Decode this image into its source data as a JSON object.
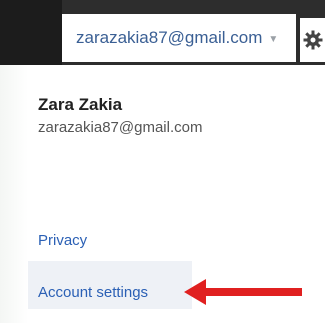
{
  "account": {
    "email_button": "zarazakia87@gmail.com",
    "name": "Zara Zakia",
    "email": "zarazakia87@gmail.com"
  },
  "menu": {
    "privacy": "Privacy",
    "account_settings": "Account settings"
  },
  "colors": {
    "topbar": "#2d2d2d",
    "link": "#2b60b5",
    "highlight_row": "#eef1f6",
    "annotation_arrow": "#e02020"
  },
  "icons": {
    "caret": "chevron-down-icon",
    "gear": "gear-icon",
    "annotation": "red-arrow-icon"
  }
}
